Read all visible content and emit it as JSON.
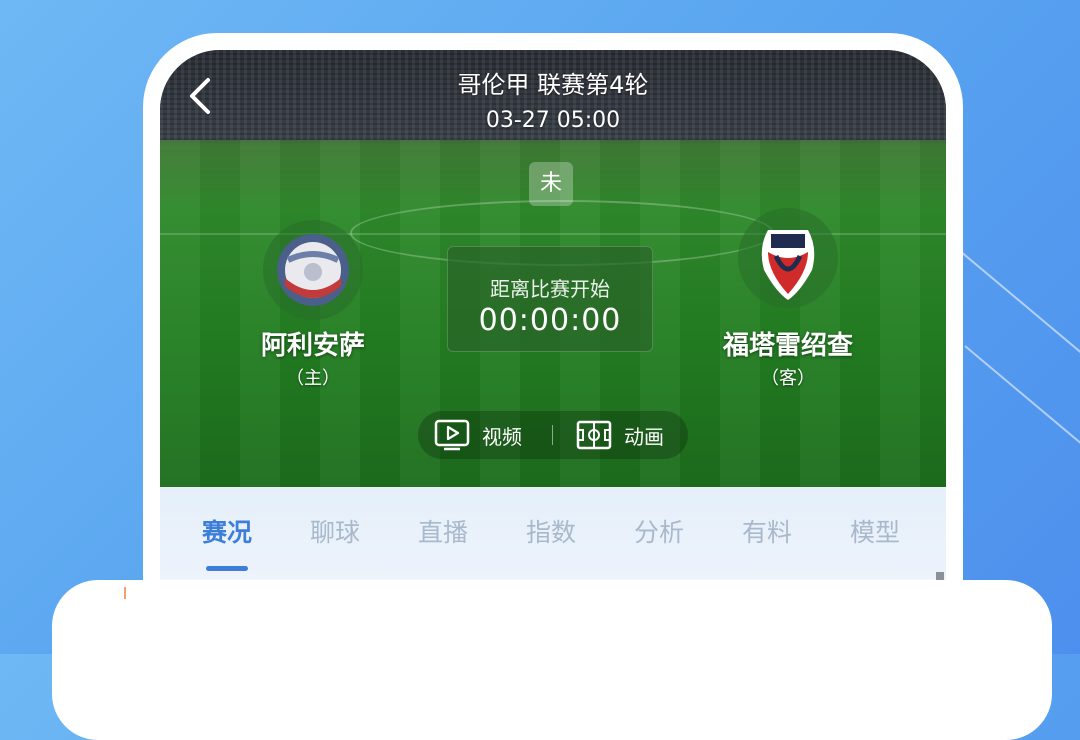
{
  "header": {
    "title": "哥伦甲  联赛第4轮",
    "datetime": "03-27  05:00",
    "status": "未"
  },
  "home_team": {
    "name": "阿利安萨",
    "role": "（主）"
  },
  "away_team": {
    "name": "福塔雷绍查",
    "role": "（客）"
  },
  "countdown": {
    "label": "距离比赛开始",
    "value": "00:00:00"
  },
  "media": {
    "video_label": "视频",
    "animation_label": "动画"
  },
  "tabs": [
    {
      "label": "赛况"
    },
    {
      "label": "聊球"
    },
    {
      "label": "直播"
    },
    {
      "label": "指数"
    },
    {
      "label": "分析"
    },
    {
      "label": "有料"
    },
    {
      "label": "模型"
    }
  ],
  "colors": {
    "accent": "#3c7ed9",
    "tab_inactive": "#a9b9cc",
    "background": "#5aa6f0"
  }
}
